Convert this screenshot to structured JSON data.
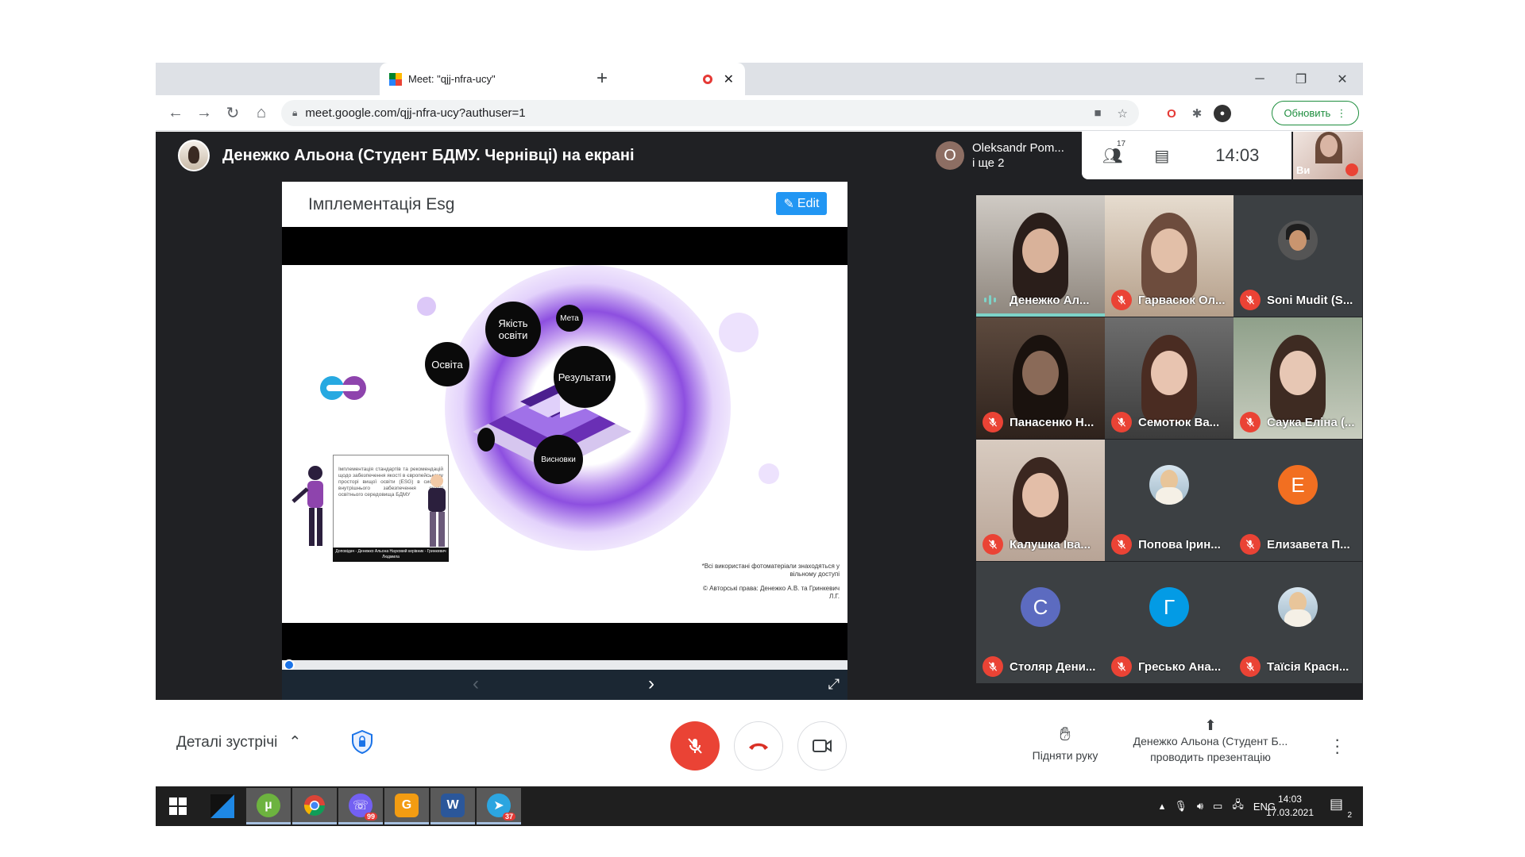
{
  "browser": {
    "tab_title": "Meet: \"qjj-nfra-ucy\"",
    "tab_close": "✕",
    "new_tab": "+",
    "url": "meet.google.com/qjj-nfra-ucy?authuser=1",
    "update_label": "Обновить",
    "win_min": "─",
    "win_max": "❐",
    "win_close": "✕"
  },
  "meet": {
    "presenter_title": "Денежко Альона (Студент БДМУ. Чернівці) на екрані",
    "others_initial": "O",
    "others_name": "Oleksandr Pom...",
    "others_more": "і ще 2",
    "participants_count": "17",
    "clock": "14:03",
    "self_label": "Ви",
    "slide": {
      "title": "Імплементація Esg",
      "edit_label": "Edit",
      "bubble_quality": "Якість освіти",
      "bubble_goal": "Мета",
      "bubble_education": "Освіта",
      "bubble_results": "Результати",
      "bubble_conclusions": "Висновки",
      "box_text": "Імплементація стандартів та рекомендацій щодо забезпечення якості в європейському просторі вищої освіти (ESG) в систему внутрішнього забезпечення якості освітнього середовища БДМУ",
      "box_footer": "Доповідач - Денежко Альона Науковий керівник - Гринкевич Людмила",
      "footnote1": "*Всі використані фотоматеріали знаходяться у вільному доступі",
      "footnote2": "© Авторські права: Денежко А.В. та Гринкевич Л.Г."
    },
    "tiles": [
      {
        "name": "Денежко Ал...",
        "kind": "video",
        "active": true
      },
      {
        "name": "Гарвасюк Ол...",
        "kind": "video"
      },
      {
        "name": "Soni Mudit (S...",
        "kind": "video"
      },
      {
        "name": "Панасенко Н...",
        "kind": "video"
      },
      {
        "name": "Семотюк Ва...",
        "kind": "video"
      },
      {
        "name": "Саука Еліна (...",
        "kind": "video"
      },
      {
        "name": "Калушка Іва...",
        "kind": "video"
      },
      {
        "name": "Попова Ірин...",
        "kind": "photo"
      },
      {
        "name": "Елизавета П...",
        "kind": "letter",
        "letter": "Е",
        "color": "#f26f21"
      },
      {
        "name": "Столяр Дени...",
        "kind": "letter",
        "letter": "С",
        "color": "#5c6bc0"
      },
      {
        "name": "Гресько Ана...",
        "kind": "letter",
        "letter": "Г",
        "color": "#039be5"
      },
      {
        "name": "Таїсія Красн...",
        "kind": "photo"
      }
    ],
    "details_label": "Деталі зустрічі",
    "raise_hand_label": "Підняти руку",
    "present_line1": "Денежко Альона (Студент Б...",
    "present_line2": "проводить презентацію"
  },
  "taskbar": {
    "viber_badge": "99",
    "telegram_badge": "37",
    "lang": "ENG",
    "time": "14:03",
    "date": "17.03.2021",
    "notif_count": "2"
  },
  "colors": {
    "meet_bg": "#202124",
    "mic_off": "#ea4335",
    "accent": "#1a73e8",
    "edit": "#2196f3"
  }
}
